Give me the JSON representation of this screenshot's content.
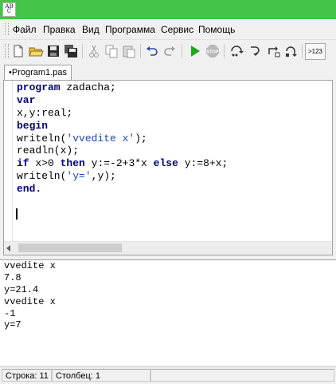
{
  "app": {
    "icon_glyph_top": "AB",
    "icon_glyph_bottom": "C"
  },
  "menu": {
    "items": [
      {
        "label": "Файл"
      },
      {
        "label": "Правка"
      },
      {
        "label": "Вид"
      },
      {
        "label": "Программа"
      },
      {
        "label": "Сервис"
      },
      {
        "label": "Помощь"
      }
    ]
  },
  "toolbar": {
    "buttons": [
      {
        "icon": "new-file-icon"
      },
      {
        "icon": "open-folder-icon"
      },
      {
        "icon": "save-icon"
      },
      {
        "icon": "save-all-icon"
      },
      {
        "icon": "cut-icon"
      },
      {
        "icon": "copy-icon"
      },
      {
        "icon": "paste-icon"
      },
      {
        "icon": "undo-icon"
      },
      {
        "icon": "redo-icon"
      },
      {
        "icon": "run-icon"
      },
      {
        "icon": "stop-icon"
      },
      {
        "icon": "step-over-icon"
      },
      {
        "icon": "step-into-icon"
      },
      {
        "icon": "step-out-icon"
      },
      {
        "icon": "run-to-cursor-icon"
      }
    ],
    "stop_label": "STOP",
    "goto_label": ">123"
  },
  "tabs": [
    {
      "label": "•Program1.pas"
    }
  ],
  "editor": {
    "lines": [
      [
        {
          "t": "program",
          "k": "kw"
        },
        {
          "t": " zadacha;",
          "k": ""
        }
      ],
      [
        {
          "t": "var",
          "k": "kw"
        }
      ],
      [
        {
          "t": "x,y:real;",
          "k": ""
        }
      ],
      [
        {
          "t": "begin",
          "k": "kw"
        }
      ],
      [
        {
          "t": "writeln(",
          "k": ""
        },
        {
          "t": "'vvedite x'",
          "k": "str"
        },
        {
          "t": ");",
          "k": ""
        }
      ],
      [
        {
          "t": "readln(x);",
          "k": ""
        }
      ],
      [
        {
          "t": "if",
          "k": "kw"
        },
        {
          "t": " x>0 ",
          "k": ""
        },
        {
          "t": "then",
          "k": "kw"
        },
        {
          "t": " y:=-2+3*x ",
          "k": ""
        },
        {
          "t": "else",
          "k": "kw"
        },
        {
          "t": " y:=8+x;",
          "k": ""
        }
      ],
      [
        {
          "t": "writeln(",
          "k": ""
        },
        {
          "t": "'y='",
          "k": "str"
        },
        {
          "t": ",y);",
          "k": ""
        }
      ],
      [
        {
          "t": "end.",
          "k": "kw"
        }
      ]
    ]
  },
  "output": {
    "lines": [
      "vvedite x",
      "7.8",
      "y=21.4",
      "vvedite x",
      "-1",
      "y=7"
    ]
  },
  "status": {
    "line": "Строка: 11",
    "column": "Столбец: 1"
  },
  "colors": {
    "titlebar": "#44c448",
    "keyword": "#00007f",
    "string": "#1a48b8"
  }
}
